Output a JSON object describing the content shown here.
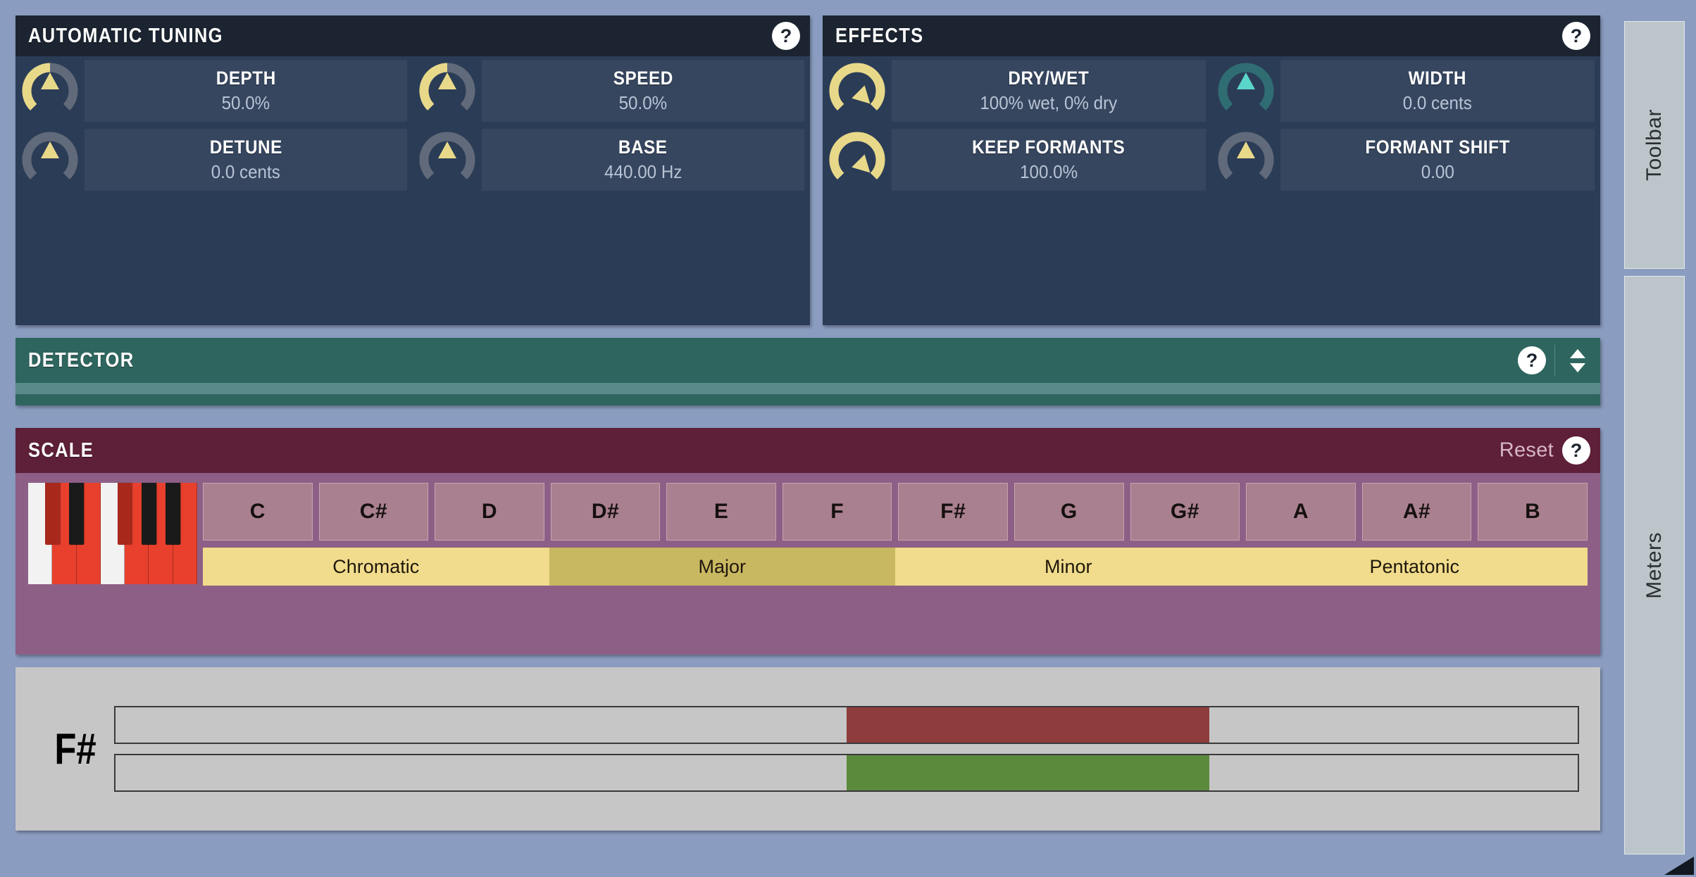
{
  "colors": {
    "app_bg": "#8a9cc0",
    "panel_bg": "#2b3c56",
    "panel_header_bg": "#1b2430",
    "knob_yellow": "#e8d98a",
    "knob_teal": "#5ad6c8",
    "knob_gray": "#6b7280",
    "detector_bg": "#2e665f",
    "scale_header_bg": "#5e1f38",
    "scale_body_bg": "#8e5f86",
    "note_btn_bg": "#a9808f",
    "preset_bg": "#f0dc8c",
    "preset_active_bg": "#c9b862",
    "meter_bg": "#c6c6c6",
    "meter_red": "#8e3c3c",
    "meter_green": "#5c8a3c",
    "key_on_red": "#e8402c",
    "key_on_dark_red": "#a8281c",
    "key_off_white": "#f2f2f2",
    "key_off_black": "#1a1a1a"
  },
  "automatic_tuning": {
    "title": "AUTOMATIC TUNING",
    "help_label": "?",
    "params": [
      {
        "name": "DEPTH",
        "value": "50.0%",
        "knob_style": "arc",
        "fill": 0.5,
        "pointer_deg": 0,
        "color": "#e8d98a"
      },
      {
        "name": "SPEED",
        "value": "50.0%",
        "knob_style": "arc",
        "fill": 0.5,
        "pointer_deg": 0,
        "color": "#e8d98a"
      },
      {
        "name": "DETUNE",
        "value": "0.0 cents",
        "knob_style": "pointer",
        "fill": 0.0,
        "pointer_deg": 0,
        "color": "#e8d98a"
      },
      {
        "name": "BASE",
        "value": "440.00 Hz",
        "knob_style": "pointer",
        "fill": 0.0,
        "pointer_deg": 0,
        "color": "#e8d98a"
      }
    ]
  },
  "effects": {
    "title": "EFFECTS",
    "help_label": "?",
    "params": [
      {
        "name": "DRY/WET",
        "value": "100% wet, 0% dry",
        "knob_style": "arc",
        "fill": 1.0,
        "pointer_deg": 135,
        "color": "#e8d98a"
      },
      {
        "name": "WIDTH",
        "value": "0.0 cents",
        "knob_style": "pointer",
        "fill": 0.0,
        "pointer_deg": 0,
        "color": "#5ad6c8"
      },
      {
        "name": "KEEP FORMANTS",
        "value": "100.0%",
        "knob_style": "arc",
        "fill": 1.0,
        "pointer_deg": 135,
        "color": "#e8d98a"
      },
      {
        "name": "FORMANT SHIFT",
        "value": "0.00",
        "knob_style": "pointer",
        "fill": 0.0,
        "pointer_deg": 0,
        "color": "#e8d98a"
      }
    ]
  },
  "detector": {
    "title": "DETECTOR",
    "help_label": "?",
    "expand_label": "expand-collapse"
  },
  "scale": {
    "title": "SCALE",
    "reset_label": "Reset",
    "help_label": "?",
    "notes": [
      {
        "label": "C",
        "active": false
      },
      {
        "label": "C#",
        "active": true
      },
      {
        "label": "D",
        "active": true
      },
      {
        "label": "D#",
        "active": false
      },
      {
        "label": "E",
        "active": true
      },
      {
        "label": "F",
        "active": false
      },
      {
        "label": "F#",
        "active": true
      },
      {
        "label": "G",
        "active": true
      },
      {
        "label": "G#",
        "active": false
      },
      {
        "label": "A",
        "active": true
      },
      {
        "label": "A#",
        "active": false
      },
      {
        "label": "B",
        "active": true
      }
    ],
    "presets": [
      {
        "label": "Chromatic",
        "active": false
      },
      {
        "label": "Major",
        "active": true
      },
      {
        "label": "Minor",
        "active": false
      },
      {
        "label": "Pentatonic",
        "active": false
      }
    ],
    "keyboard": {
      "white_keys": [
        {
          "note": "C",
          "on": false
        },
        {
          "note": "D",
          "on": true
        },
        {
          "note": "E",
          "on": true
        },
        {
          "note": "F",
          "on": false
        },
        {
          "note": "G",
          "on": true
        },
        {
          "note": "A",
          "on": true
        },
        {
          "note": "B",
          "on": true
        }
      ],
      "black_keys": [
        {
          "note": "C#",
          "on": true,
          "after": 0
        },
        {
          "note": "D#",
          "on": false,
          "after": 1
        },
        {
          "note": "F#",
          "on": true,
          "after": 3
        },
        {
          "note": "G#",
          "on": false,
          "after": 4
        },
        {
          "note": "A#",
          "on": false,
          "after": 5
        }
      ]
    }
  },
  "meter": {
    "note": "F#",
    "bars": [
      {
        "name": "pitch-deviation-bar",
        "start_pct": 50.0,
        "end_pct": 74.8,
        "color": "#8e3c3c"
      },
      {
        "name": "correction-bar",
        "start_pct": 50.0,
        "end_pct": 74.8,
        "color": "#5c8a3c"
      }
    ]
  },
  "sidebar": {
    "tabs": [
      {
        "label": "Toolbar"
      },
      {
        "label": "Meters"
      }
    ]
  }
}
